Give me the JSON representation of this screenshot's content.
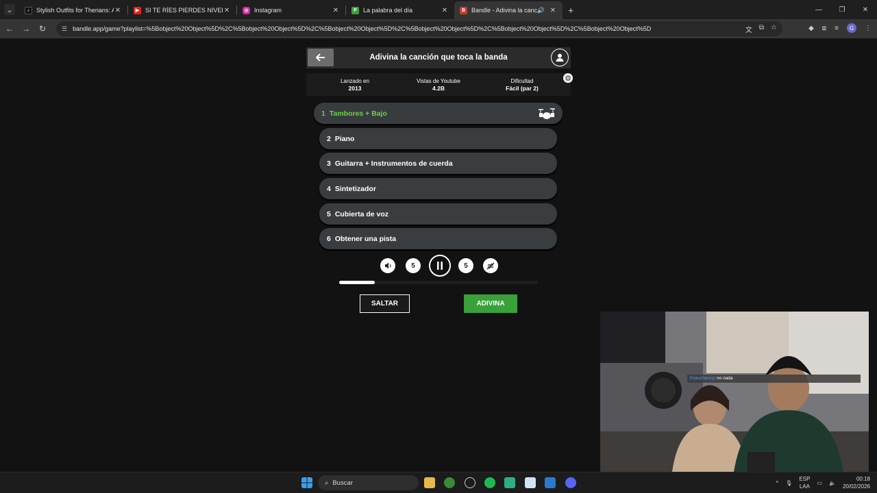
{
  "browser": {
    "tabs": [
      {
        "title": "Stylish Outfits for Therians: A G",
        "icon": "tiktok-icon",
        "color": "#111111"
      },
      {
        "title": "SI TE RÍES PIERDES NIVEL DIOS",
        "icon": "youtube-icon",
        "color": "#e62117"
      },
      {
        "title": "Instagram",
        "icon": "instagram-icon",
        "color": "#d6249f"
      },
      {
        "title": "La palabra del día",
        "icon": "palabra-icon",
        "color": "#3aa03a"
      },
      {
        "title": "Bandle - Adivina la canción",
        "icon": "bandle-icon",
        "color": "#c83c2c",
        "active": true
      }
    ],
    "url": "bandle.app/game?playlist=%5Bobject%20Object%5D%2C%5Bobject%20Object%5D%2C%5Bobject%20Object%5D%2C%5Bobject%20Object%5D%2C%5Bobject%20Object%5D%2C%5Bobject%20Object%5D",
    "profile_initial": "G"
  },
  "game": {
    "title": "Adivina la canción que toca la banda",
    "info": [
      {
        "label": "Lanzado en",
        "value": "2013"
      },
      {
        "label": "Vistas de Youtube",
        "value": "4.2B"
      },
      {
        "label": "Dificultad",
        "value": "Fácil (par 2)"
      }
    ],
    "clues": [
      {
        "num": "1",
        "label": "Tambores + Bajo"
      },
      {
        "num": "2",
        "label": "Piano"
      },
      {
        "num": "3",
        "label": "Guitarra + Instrumentos de cuerda"
      },
      {
        "num": "4",
        "label": "Sintetizador"
      },
      {
        "num": "5",
        "label": "Cubierta de voz"
      },
      {
        "num": "6",
        "label": "Obtener una pista"
      }
    ],
    "rewind_seconds": "5",
    "forward_seconds": "5",
    "progress": 0.18,
    "skip_label": "SALTAR",
    "guess_label": "ADIVINA",
    "accent_green": "#6cd04a",
    "guess_green": "#3aa03a"
  },
  "stream": {
    "chat_nick": "Ezeuchenvy",
    "chat_msg": ": no nada"
  },
  "taskbar": {
    "search_label": "Buscar",
    "lang_top": "ESP",
    "lang_bottom": "LAA",
    "time": "00:18",
    "date": "20/02/2026"
  }
}
